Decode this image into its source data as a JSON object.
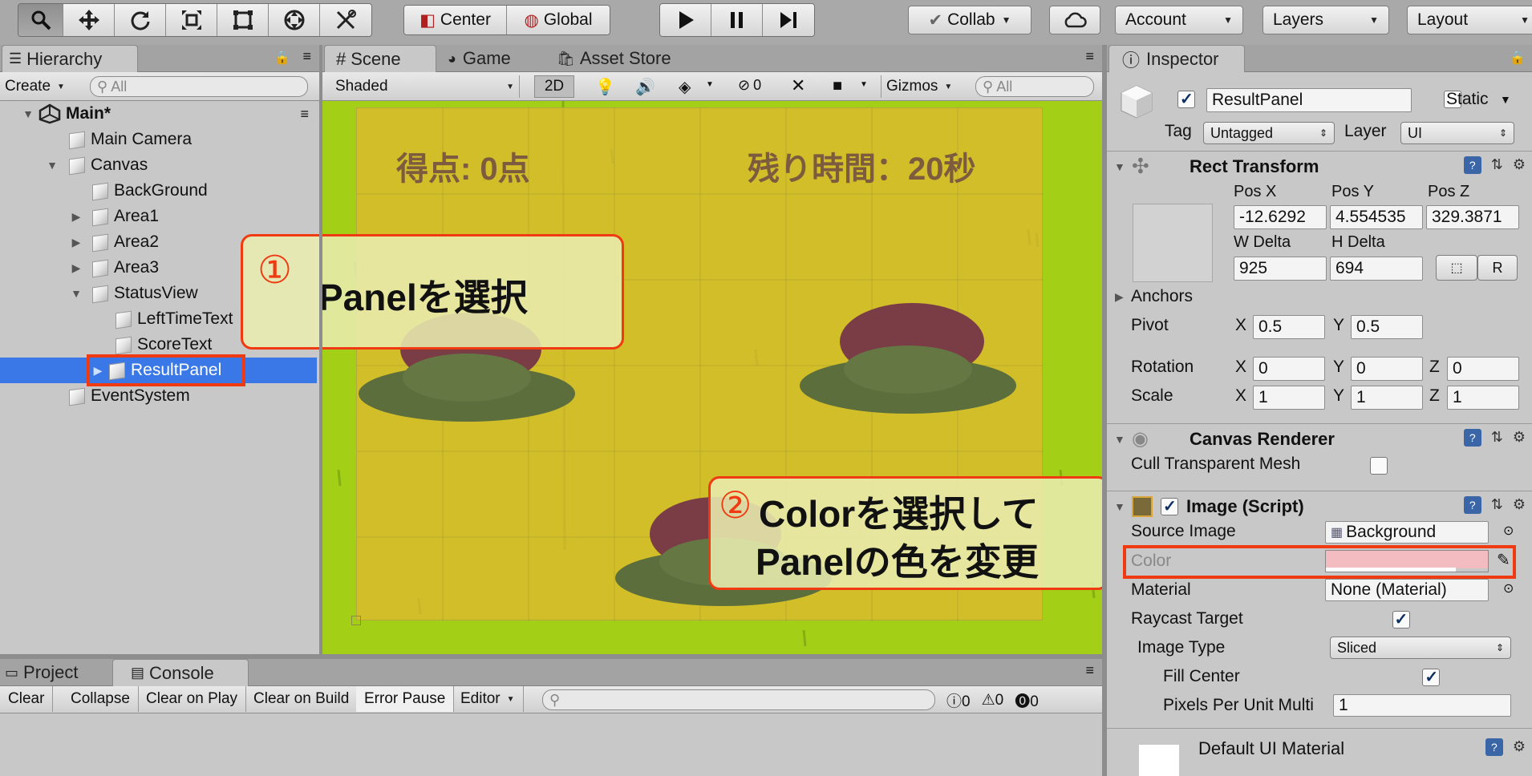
{
  "toolbar": {
    "tools": [
      "hand-icon",
      "move-icon",
      "rotate-icon",
      "scale-icon",
      "rect-tool-icon",
      "transform-icon",
      "custom-tool-icon"
    ],
    "pivot": "Center",
    "space": "Global",
    "play": "play-icon",
    "pause": "pause-icon",
    "step": "step-icon",
    "collab": "Collab",
    "cloud": "cloud-icon",
    "account": "Account",
    "layers": "Layers",
    "layout": "Layout"
  },
  "hierarchy": {
    "tab": "Hierarchy",
    "create": "Create",
    "search_placeholder": "All",
    "scene": "Main*",
    "items": [
      "Main Camera",
      "Canvas",
      "BackGround",
      "Area1",
      "Area2",
      "Area3",
      "StatusView",
      "LeftTimeText",
      "ScoreText",
      "ResultPanel",
      "EventSystem"
    ]
  },
  "scene": {
    "tabs": [
      "Scene",
      "Game",
      "Asset Store"
    ],
    "shading": "Shaded",
    "mode2d": "2D",
    "hidden_count": "0",
    "gizmos": "Gizmos",
    "search_placeholder": "All",
    "score_text": "得点: 0点",
    "time_text": "残り時間：20秒"
  },
  "callout1": {
    "num": "①",
    "text": "Panelを選択"
  },
  "callout2": {
    "num": "②",
    "line1": "Colorを選択して",
    "line2": "Panelの色を変更"
  },
  "inspector": {
    "tab": "Inspector",
    "object_name": "ResultPanel",
    "static_label": "Static",
    "tag_label": "Tag",
    "tag_value": "Untagged",
    "layer_label": "Layer",
    "layer_value": "UI",
    "rect": {
      "title": "Rect Transform",
      "posx_l": "Pos X",
      "posy_l": "Pos Y",
      "posz_l": "Pos Z",
      "posx": "-12.6292",
      "posy": "4.554535",
      "posz": "329.3871",
      "w_l": "W Delta",
      "h_l": "H Delta",
      "w": "925",
      "h": "694",
      "r_btn": "R",
      "anchors": "Anchors",
      "pivot": "Pivot",
      "pivot_x": "0.5",
      "pivot_y": "0.5",
      "rotation": "Rotation",
      "rot_x": "0",
      "rot_y": "0",
      "rot_z": "0",
      "scale": "Scale",
      "sc_x": "1",
      "sc_y": "1",
      "sc_z": "1",
      "x": "X",
      "y": "Y",
      "z": "Z"
    },
    "canvas_renderer": {
      "title": "Canvas Renderer",
      "cull": "Cull Transparent Mesh"
    },
    "image": {
      "title": "Image (Script)",
      "source_l": "Source Image",
      "source": "Background",
      "color_l": "Color",
      "color_hex": "#f2bcc0",
      "material_l": "Material",
      "material": "None (Material)",
      "raycast_l": "Raycast Target",
      "type_l": "Image Type",
      "type": "Sliced",
      "fill_l": "Fill Center",
      "ppu_l": "Pixels Per Unit Multi",
      "ppu": "1"
    },
    "material_title": "Default UI Material"
  },
  "console": {
    "tabs": [
      "Project",
      "Console"
    ],
    "buttons": [
      "Clear",
      "Collapse",
      "Clear on Play",
      "Clear on Build",
      "Error Pause",
      "Editor"
    ],
    "info_count": "0",
    "warn_count": "0",
    "error_count": "0"
  }
}
